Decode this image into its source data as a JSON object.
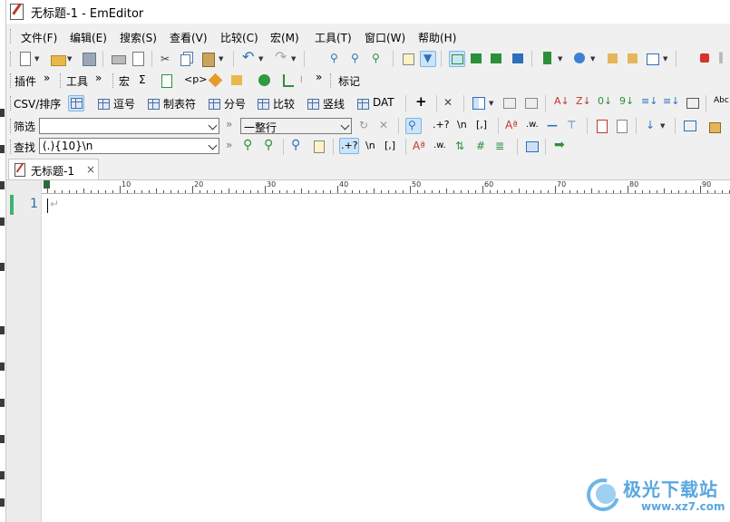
{
  "app": {
    "title": "无标题-1 - EmEditor"
  },
  "menu": [
    "文件(F)",
    "编辑(E)",
    "搜索(S)",
    "查看(V)",
    "比较(C)",
    "宏(M)",
    "工具(T)",
    "窗口(W)",
    "帮助(H)"
  ],
  "toolbar2": {
    "plugins_label": "插件",
    "tools_label": "工具",
    "macro_label": "宏",
    "sigma": "Σ",
    "tag_glyph": "<p>",
    "markers_label": "标记"
  },
  "csvbar": {
    "csv_label": "CSV/排序",
    "items": [
      "逗号",
      "制表符",
      "分号",
      "比较",
      "竖线",
      "DAT"
    ]
  },
  "filterbar": {
    "label": "筛选",
    "value": "",
    "mode_value": "一整行",
    "regex": ".+?",
    "newline": "\\n",
    "bracket": "[,]"
  },
  "findbar": {
    "label": "查找",
    "value": "(.){10}\\n",
    "regex": ".+?",
    "newline": "\\n",
    "bracket": "[,]"
  },
  "tab": {
    "label": "无标题-1",
    "close": "×"
  },
  "editor": {
    "line_number": "1",
    "ruler_numbers": [
      "10",
      "20",
      "30",
      "40",
      "50",
      "60",
      "70",
      "80",
      "90"
    ]
  },
  "watermark": {
    "text": "极光下载站",
    "url": "www.xz7.com"
  }
}
